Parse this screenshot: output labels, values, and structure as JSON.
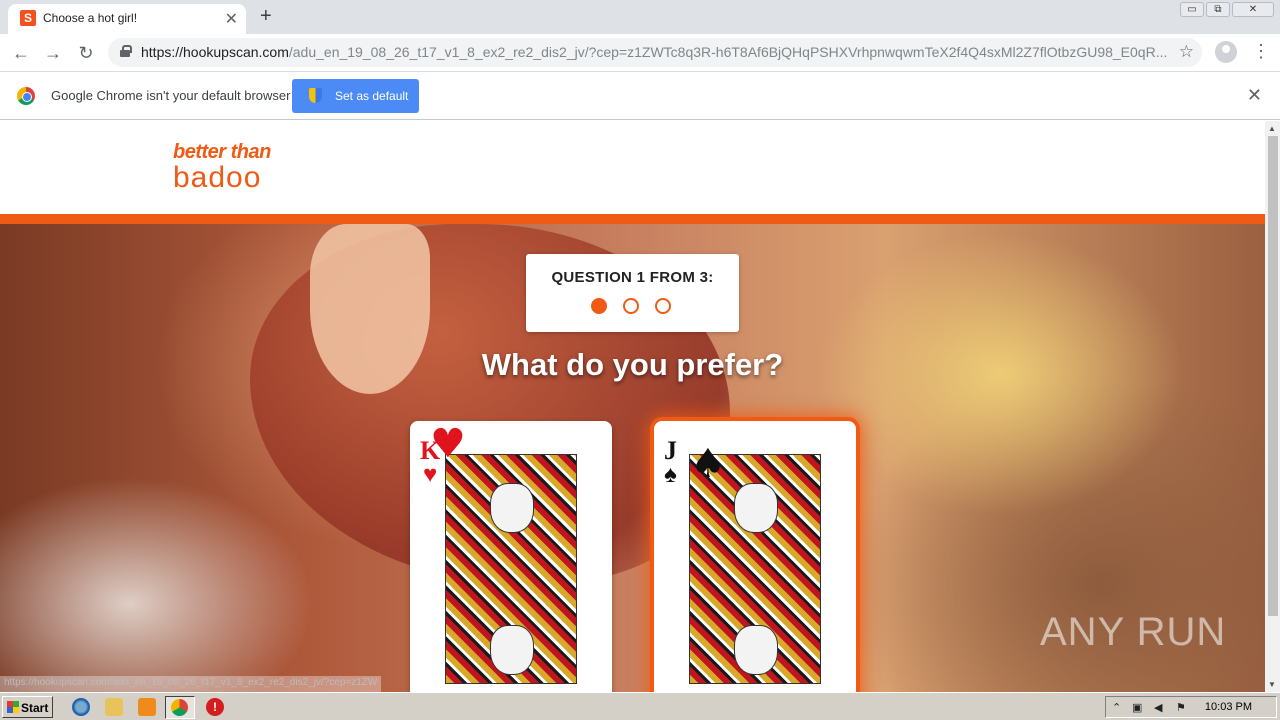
{
  "browser": {
    "tab_title": "Choose a hot girl!",
    "tab_favicon_letter": "S",
    "tab_close": "✕",
    "new_tab": "+",
    "url_host": "https://hookupscan.com",
    "url_rest": "/adu_en_19_08_26_t17_v1_8_ex2_re2_dis2_jv/?cep=z1ZWTc8q3R-h6T8Af6BjQHqPSHXVrhpnwqwmTeX2f4Q4sxMl2Z7flOtbzGU98_E0qR...",
    "window_buttons": [
      "▭",
      "⧉",
      "✕"
    ]
  },
  "infobar": {
    "message": "Google Chrome isn't your default browser",
    "button_label": "Set as default",
    "close": "✕"
  },
  "page": {
    "logo_top": "better than",
    "logo_brand": "badoo",
    "question_label": "QUESTION 1 FROM 3:",
    "question_progress": {
      "current": 1,
      "total": 3
    },
    "prompt": "What do you prefer?",
    "cards": [
      {
        "rank": "K",
        "suit": "♥",
        "suit_name": "hearts",
        "color": "#e0141e"
      },
      {
        "rank": "J",
        "suit": "♠",
        "suit_name": "spades",
        "color": "#111111"
      }
    ],
    "status_url": "https://hookupscan.com/adu_en_19_08_26_t17_v1_8_ex2_re2_dis2_jv/?cep=z1ZW",
    "watermark": "ANY RUN"
  },
  "taskbar": {
    "start_label": "Start",
    "clock": "10:03 PM",
    "stop_glyph": "!"
  },
  "colors": {
    "brand": "#f05a14",
    "chrome_blue": "#4c8bf5"
  },
  "icons": [
    "back-icon",
    "forward-icon",
    "reload-icon",
    "lock-icon",
    "star-icon",
    "profile-icon",
    "menu-icon",
    "chrome-icon",
    "shield-icon"
  ]
}
